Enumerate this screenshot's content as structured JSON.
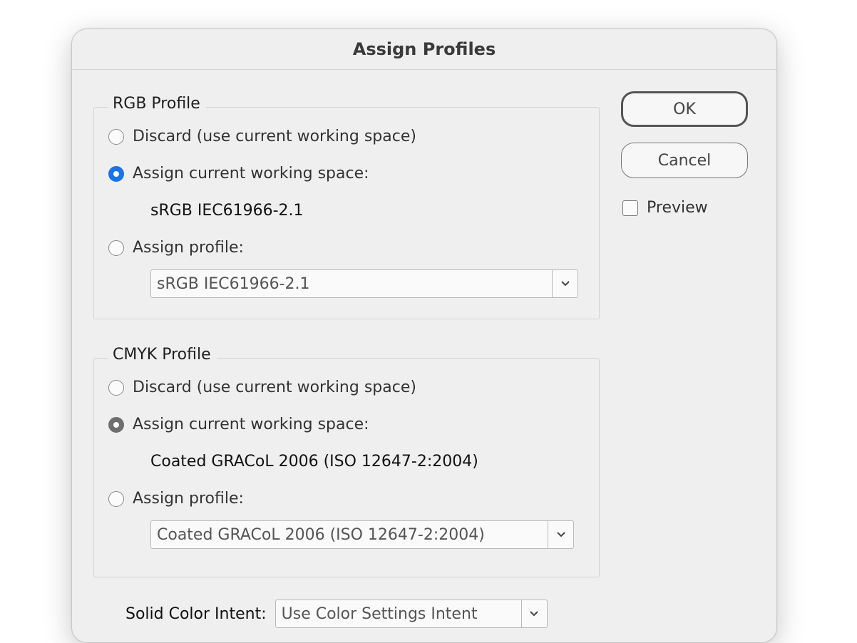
{
  "dialog": {
    "title": "Assign Profiles"
  },
  "rgb": {
    "group_label": "RGB Profile",
    "discard_label": "Discard (use current working space)",
    "assign_current_label": "Assign current working space:",
    "current_space": "sRGB IEC61966-2.1",
    "assign_profile_label": "Assign profile:",
    "profile_select_value": "sRGB IEC61966-2.1",
    "selected_option": "assign_current"
  },
  "cmyk": {
    "group_label": "CMYK Profile",
    "discard_label": "Discard (use current working space)",
    "assign_current_label": "Assign current working space:",
    "current_space": "Coated GRACoL 2006 (ISO 12647-2:2004)",
    "assign_profile_label": "Assign profile:",
    "profile_select_value": "Coated GRACoL 2006 (ISO 12647-2:2004)",
    "selected_option": "assign_current"
  },
  "buttons": {
    "ok_label": "OK",
    "cancel_label": "Cancel"
  },
  "preview": {
    "label": "Preview",
    "checked": false
  },
  "intent": {
    "label": "Solid Color Intent:",
    "value": "Use Color Settings Intent"
  },
  "colors": {
    "accent": "#1a73e8",
    "dialog_bg": "#efefef"
  }
}
